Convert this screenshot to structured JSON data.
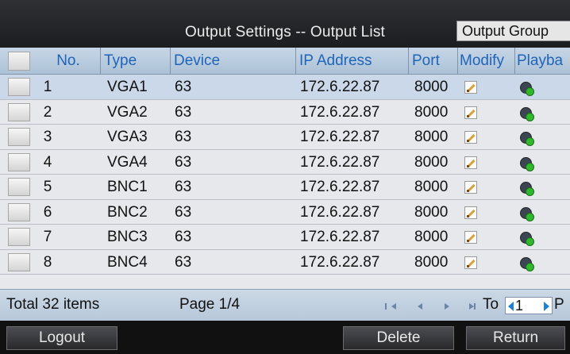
{
  "header": {
    "title": "Output Settings -- Output List",
    "group_button": "Output Group"
  },
  "table": {
    "columns": [
      "No.",
      "Type",
      "Device",
      "IP Address",
      "Port",
      "Modify",
      "Playba"
    ],
    "rows": [
      {
        "no": "1",
        "type": "VGA1",
        "device": "63",
        "ip": "172.6.22.87",
        "port": "8000"
      },
      {
        "no": "2",
        "type": "VGA2",
        "device": "63",
        "ip": "172.6.22.87",
        "port": "8000"
      },
      {
        "no": "3",
        "type": "VGA3",
        "device": "63",
        "ip": "172.6.22.87",
        "port": "8000"
      },
      {
        "no": "4",
        "type": "VGA4",
        "device": "63",
        "ip": "172.6.22.87",
        "port": "8000"
      },
      {
        "no": "5",
        "type": "BNC1",
        "device": "63",
        "ip": "172.6.22.87",
        "port": "8000"
      },
      {
        "no": "6",
        "type": "BNC2",
        "device": "63",
        "ip": "172.6.22.87",
        "port": "8000"
      },
      {
        "no": "7",
        "type": "BNC3",
        "device": "63",
        "ip": "172.6.22.87",
        "port": "8000"
      },
      {
        "no": "8",
        "type": "BNC4",
        "device": "63",
        "ip": "172.6.22.87",
        "port": "8000"
      }
    ],
    "modify_icon": "edit-pencil-icon",
    "playback_icon": "playback-icon"
  },
  "pagination": {
    "total": "Total 32 items",
    "page": "Page 1/4",
    "to_label": "To",
    "page_value": "1",
    "page_suffix": "P"
  },
  "buttons": {
    "logout": "Logout",
    "delete": "Delete",
    "return": "Return"
  },
  "colors": {
    "header_text": "#1f64b9",
    "selected_row": "#cad8ea",
    "accent_arrow": "#1f7fd6"
  }
}
